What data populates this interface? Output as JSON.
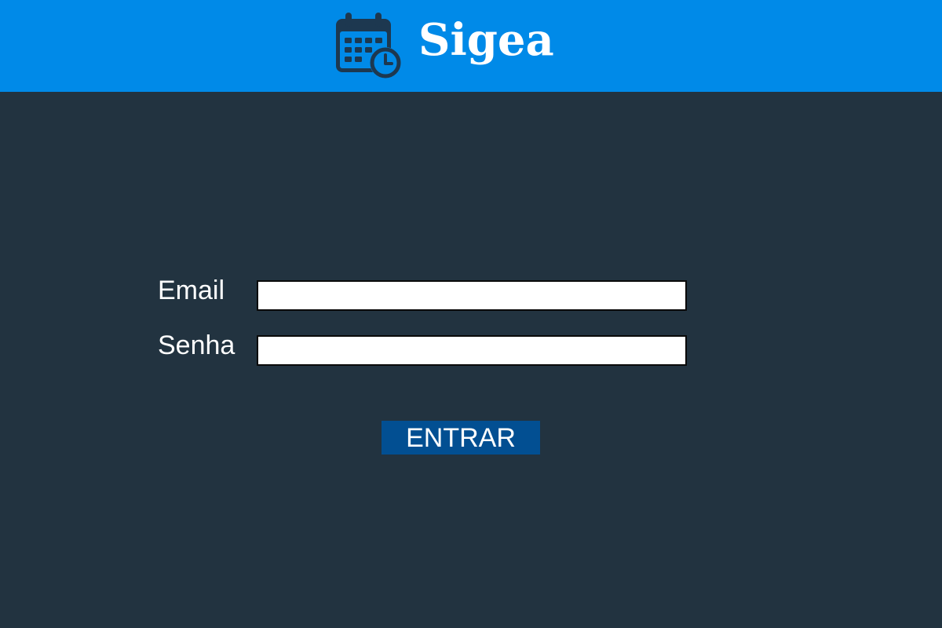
{
  "header": {
    "brand_name": "Sigea",
    "logo_icon": "calendar-clock-icon",
    "background_color": "#008ae8"
  },
  "login_form": {
    "email_label": "Email",
    "email_value": "",
    "password_label": "Senha",
    "password_value": "",
    "submit_label": "ENTRAR",
    "submit_color": "#024f92"
  },
  "page": {
    "background_color": "#223340"
  }
}
